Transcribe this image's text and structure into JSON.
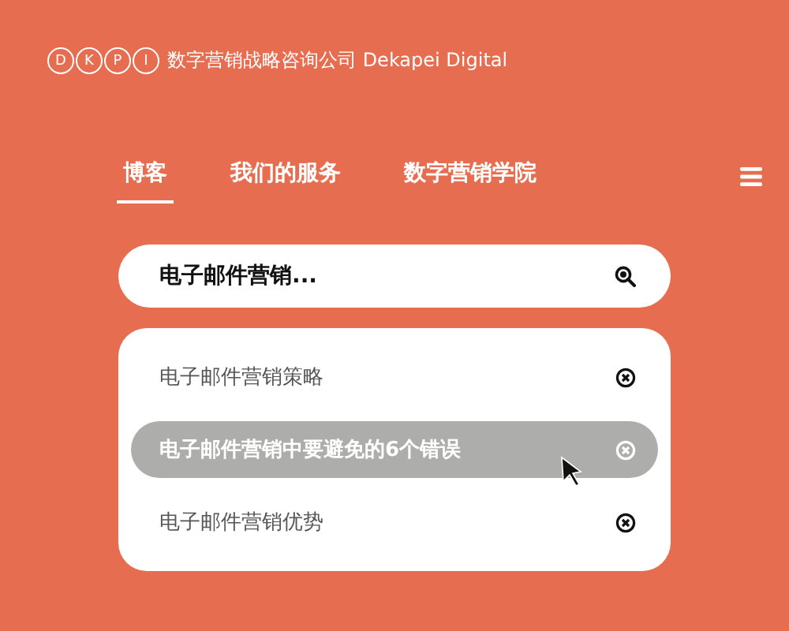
{
  "logo": {
    "letters": [
      "D",
      "K",
      "P",
      "I"
    ],
    "name": "数字营销战略咨询公司 Dekapei Digital"
  },
  "tabs": [
    {
      "label": "博客",
      "selected": true
    },
    {
      "label": "我们的服务",
      "selected": false
    },
    {
      "label": "数字营销学院",
      "selected": false
    }
  ],
  "search": {
    "value": "电子邮件营销..."
  },
  "suggestions": [
    {
      "text": "电子邮件营销策略",
      "selected": false
    },
    {
      "text": "电子邮件营销中要避免的6个错误",
      "selected": true
    },
    {
      "text": "电子邮件营销优势",
      "selected": false
    }
  ]
}
